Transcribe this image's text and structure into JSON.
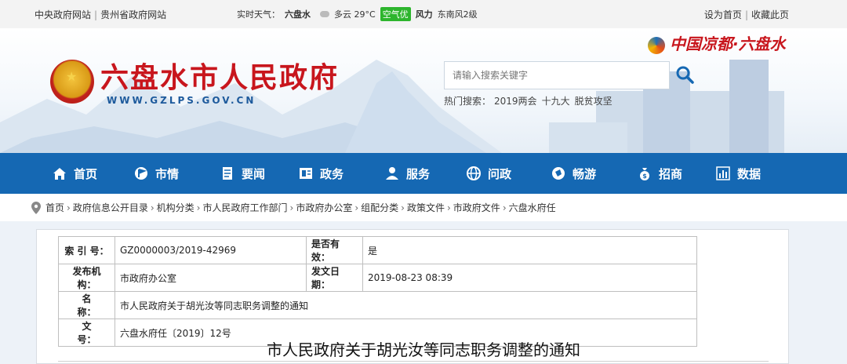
{
  "topbar": {
    "link1": "中央政府网站",
    "link2": "贵州省政府网站",
    "weather_label": "实时天气：",
    "city": "六盘水",
    "sky": "多云 29°C",
    "air_quality": "空气优",
    "wind_label": "风力",
    "wind": "东南风2级",
    "set_home": "设为首页",
    "favorite": "收藏此页"
  },
  "header": {
    "site_title": "六盘水市人民政府",
    "site_url": "WWW.GZLPS.GOV.CN",
    "brand": "中国凉都·六盘水",
    "search_placeholder": "请输入搜索关键字",
    "hot_label": "热门搜索：",
    "hot_terms": [
      "2019两会",
      "十九大",
      "脱贫攻坚"
    ]
  },
  "nav": {
    "items": [
      {
        "label": "首页",
        "icon": "home-icon"
      },
      {
        "label": "市情",
        "icon": "flag-icon"
      },
      {
        "label": "要闻",
        "icon": "news-icon"
      },
      {
        "label": "政务",
        "icon": "government-icon"
      },
      {
        "label": "服务",
        "icon": "service-icon"
      },
      {
        "label": "问政",
        "icon": "globe-icon"
      },
      {
        "label": "畅游",
        "icon": "travel-icon"
      },
      {
        "label": "招商",
        "icon": "money-bag-icon"
      },
      {
        "label": "数据",
        "icon": "bar-chart-icon"
      }
    ]
  },
  "breadcrumb": [
    "首页",
    "政府信息公开目录",
    "机构分类",
    "市人民政府工作部门",
    "市政府办公室",
    "组配分类",
    "政策文件",
    "市政府文件",
    "六盘水府任"
  ],
  "meta": {
    "index_label": "索 引 号：",
    "index_value": "GZ0000003/2019-42969",
    "valid_label": "是否有效：",
    "valid_value": "是",
    "issuer_label": "发布机构：",
    "issuer_value": "市政府办公室",
    "date_label": "发文日期：",
    "date_value": "2019-08-23 08:39",
    "name_label": "名　　称：",
    "name_value": "市人民政府关于胡光汝等同志职务调整的通知",
    "docno_label": "文　　号：",
    "docno_value": "六盘水府任〔2019〕12号"
  },
  "document": {
    "title": "市人民政府关于胡光汝等同志职务调整的通知"
  },
  "colors": {
    "nav_blue": "#1568b3",
    "title_red": "#c8161d",
    "url_blue": "#1d5a9c",
    "air_green": "#2db52d"
  }
}
